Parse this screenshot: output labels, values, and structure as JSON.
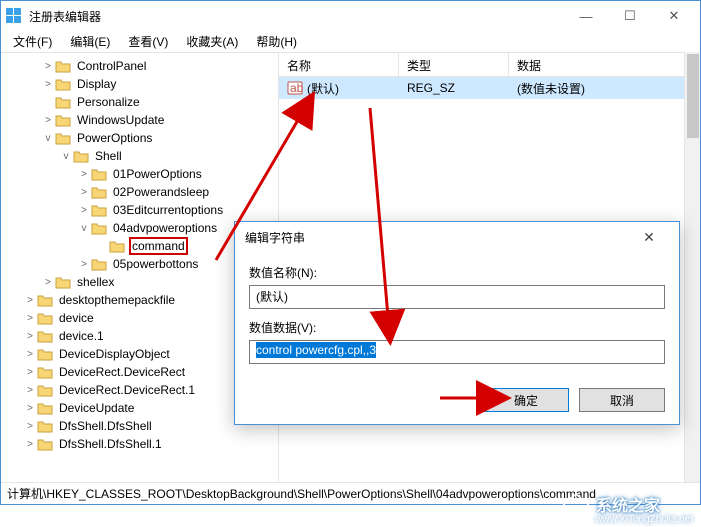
{
  "window": {
    "title": "注册表编辑器"
  },
  "menu": {
    "file": "文件(F)",
    "edit": "编辑(E)",
    "view": "查看(V)",
    "fav": "收藏夹(A)",
    "help": "帮助(H)"
  },
  "tree": {
    "items": [
      {
        "label": "ControlPanel",
        "exp": ">"
      },
      {
        "label": "Display",
        "exp": ">"
      },
      {
        "label": "Personalize",
        "exp": ""
      },
      {
        "label": "WindowsUpdate",
        "exp": ">"
      }
    ],
    "power": {
      "label": "PowerOptions",
      "exp": "v"
    },
    "shell": {
      "label": "Shell",
      "exp": "v"
    },
    "shellChildren": [
      {
        "label": "01PowerOptions",
        "exp": ">"
      },
      {
        "label": "02Powerandsleep",
        "exp": ">"
      },
      {
        "label": "03Editcurrentoptions",
        "exp": ">"
      }
    ],
    "adv": {
      "label": "04advpoweroptions",
      "exp": "v"
    },
    "command": {
      "label": "command",
      "exp": ""
    },
    "fifth": {
      "label": "05powerbottons",
      "exp": ">"
    },
    "shellex": {
      "label": "shellex",
      "exp": ">"
    },
    "rest": [
      {
        "label": "desktopthemepackfile",
        "exp": ">"
      },
      {
        "label": "device",
        "exp": ">"
      },
      {
        "label": "device.1",
        "exp": ">"
      },
      {
        "label": "DeviceDisplayObject",
        "exp": ">"
      },
      {
        "label": "DeviceRect.DeviceRect",
        "exp": ">"
      },
      {
        "label": "DeviceRect.DeviceRect.1",
        "exp": ">"
      },
      {
        "label": "DeviceUpdate",
        "exp": ">"
      },
      {
        "label": "DfsShell.DfsShell",
        "exp": ">"
      },
      {
        "label": "DfsShell.DfsShell.1",
        "exp": ">"
      }
    ]
  },
  "list": {
    "head": {
      "name": "名称",
      "type": "类型",
      "data": "数据"
    },
    "row": {
      "name": "(默认)",
      "type": "REG_SZ",
      "data": "(数值未设置)"
    }
  },
  "dialog": {
    "title": "编辑字符串",
    "nameLabel": "数值名称(N):",
    "nameValue": "(默认)",
    "dataLabel": "数值数据(V):",
    "dataValue": "control powercfg.cpl,,3",
    "ok": "确定",
    "cancel": "取消"
  },
  "statusbar": "计算机\\HKEY_CLASSES_ROOT\\DesktopBackground\\Shell\\PowerOptions\\Shell\\04advpoweroptions\\command",
  "watermark": {
    "text": "系统之家",
    "sub": "www.XiTongZhiJia.net"
  }
}
